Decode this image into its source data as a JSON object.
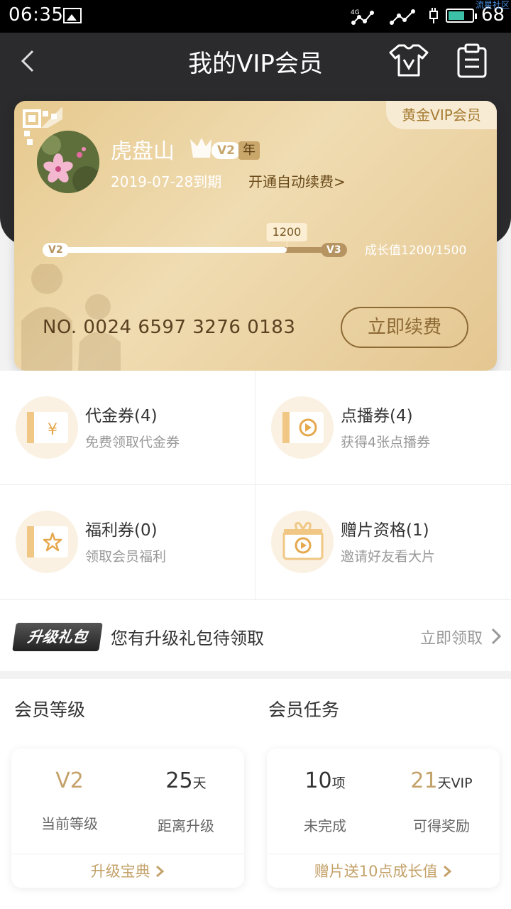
{
  "status": {
    "time": "06:35",
    "network": "4G",
    "battery": "68",
    "watermark": "流星社区"
  },
  "nav": {
    "title": "我的VIP会员"
  },
  "card": {
    "tier_label": "黄金VIP会员",
    "username": "虎盘山",
    "vip_level": "V2",
    "year_badge": "年",
    "expiry": "2019-07-28到期",
    "auto_renew": "开通自动续费>",
    "progress": {
      "from": "V2",
      "to": "V3",
      "current": "1200",
      "value": 1200,
      "max": 1500,
      "growth_text": "成长值1200/1500"
    },
    "card_number": "NO. 0024 6597 3276 0183",
    "renew_button": "立即续费"
  },
  "tickets": [
    {
      "title": "代金券(4)",
      "subtitle": "免费领取代金券",
      "icon": "yuan-ticket-icon"
    },
    {
      "title": "点播券(4)",
      "subtitle": "获得4张点播券",
      "icon": "play-ticket-icon"
    },
    {
      "title": "福利券(0)",
      "subtitle": "领取会员福利",
      "icon": "star-ticket-icon"
    },
    {
      "title": "赠片资格(1)",
      "subtitle": "邀请好友看大片",
      "icon": "gift-video-icon"
    }
  ],
  "upgrade": {
    "logo_text": "升级礼包",
    "message": "您有升级礼包待领取",
    "claim": "立即领取"
  },
  "level": {
    "title": "会员等级",
    "current_value": "V2",
    "current_label": "当前等级",
    "days_value": "25",
    "days_unit": "天",
    "days_label": "距离升级",
    "link": "升级宝典"
  },
  "tasks": {
    "title": "会员任务",
    "todo_value": "10",
    "todo_unit": "项",
    "todo_label": "未完成",
    "reward_value": "21",
    "reward_unit": "天VIP",
    "reward_label": "可得奖励",
    "link": "赠片送10点成长值"
  },
  "colors": {
    "accent": "#c4a26a",
    "header": "#2b2b2d",
    "card_gold": "#e6c98e"
  }
}
